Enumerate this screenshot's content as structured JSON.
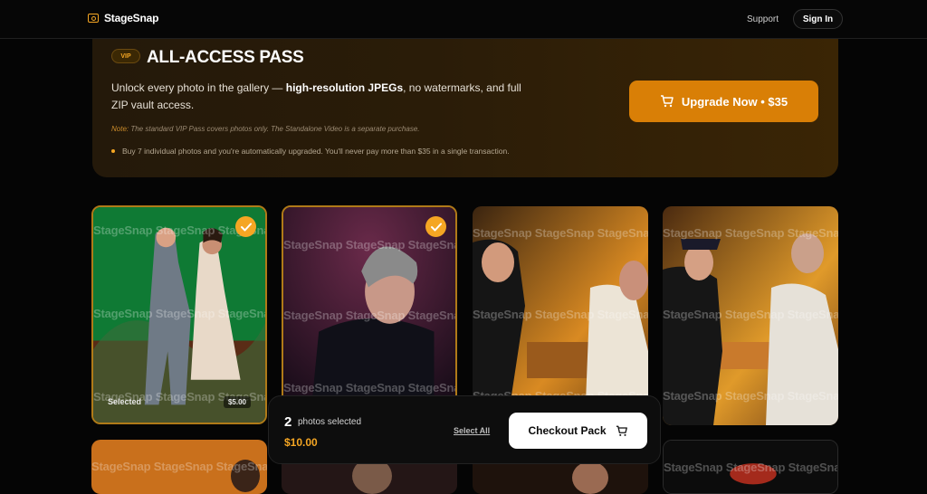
{
  "header": {
    "brand": "StageSnap",
    "support": "Support",
    "sign_in": "Sign In"
  },
  "vip": {
    "badge": "VIP",
    "title": "ALL-ACCESS PASS",
    "desc_pre": "Unlock every photo in the gallery — ",
    "desc_bold": "high-resolution JPEGs",
    "desc_post": ", no watermarks, and full ZIP vault access.",
    "note_label": "Note:",
    "note_text": " The standard VIP Pass covers photos only. The Standalone Video is a separate purchase.",
    "bullet": "Buy 7 individual photos and you're automatically upgraded. You'll never pay more than $35 in a single transaction.",
    "upgrade_label": "Upgrade Now • $35"
  },
  "watermark": "StageSnap",
  "gallery": {
    "cards": [
      {
        "selected": true,
        "selected_label": "Selected",
        "price": "$5.00"
      },
      {
        "selected": true
      },
      {
        "selected": false
      },
      {
        "selected": false
      }
    ]
  },
  "checkout": {
    "count": "2",
    "count_label": "photos selected",
    "total": "$10.00",
    "select_all": "Select All",
    "button_label": "Checkout Pack"
  },
  "colors": {
    "accent": "#f5a623",
    "upgrade_button": "#d97f06",
    "page_bg": "#050505"
  },
  "icons": [
    "camera-icon",
    "cart-icon",
    "checkmark-icon"
  ]
}
